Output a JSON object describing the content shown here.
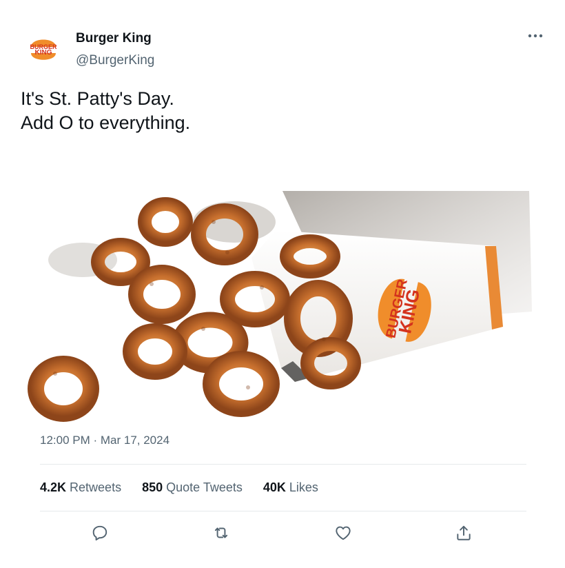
{
  "author": {
    "display_name": "Burger King",
    "handle": "@BurgerKing",
    "avatar_logo_text": [
      "BURGER",
      "KING"
    ]
  },
  "tweet": {
    "text_lines": [
      "It's St. Patty's Day.",
      "Add O to everything."
    ],
    "media_logo_text": [
      "BURGER",
      "KING"
    ],
    "timestamp": "12:00 PM · Mar 17, 2024"
  },
  "stats": {
    "retweets": {
      "count": "4.2K",
      "label": "Retweets"
    },
    "quotes": {
      "count": "850",
      "label": "Quote Tweets"
    },
    "likes": {
      "count": "40K",
      "label": "Likes"
    }
  },
  "icons": {
    "more": "more-icon",
    "reply": "reply-icon",
    "retweet": "retweet-icon",
    "like": "heart-icon",
    "share": "share-icon"
  },
  "colors": {
    "text_primary": "#0f1419",
    "text_secondary": "#536471",
    "brand_orange": "#f08d2b",
    "brand_red": "#d4321d",
    "icon": "#536471"
  }
}
